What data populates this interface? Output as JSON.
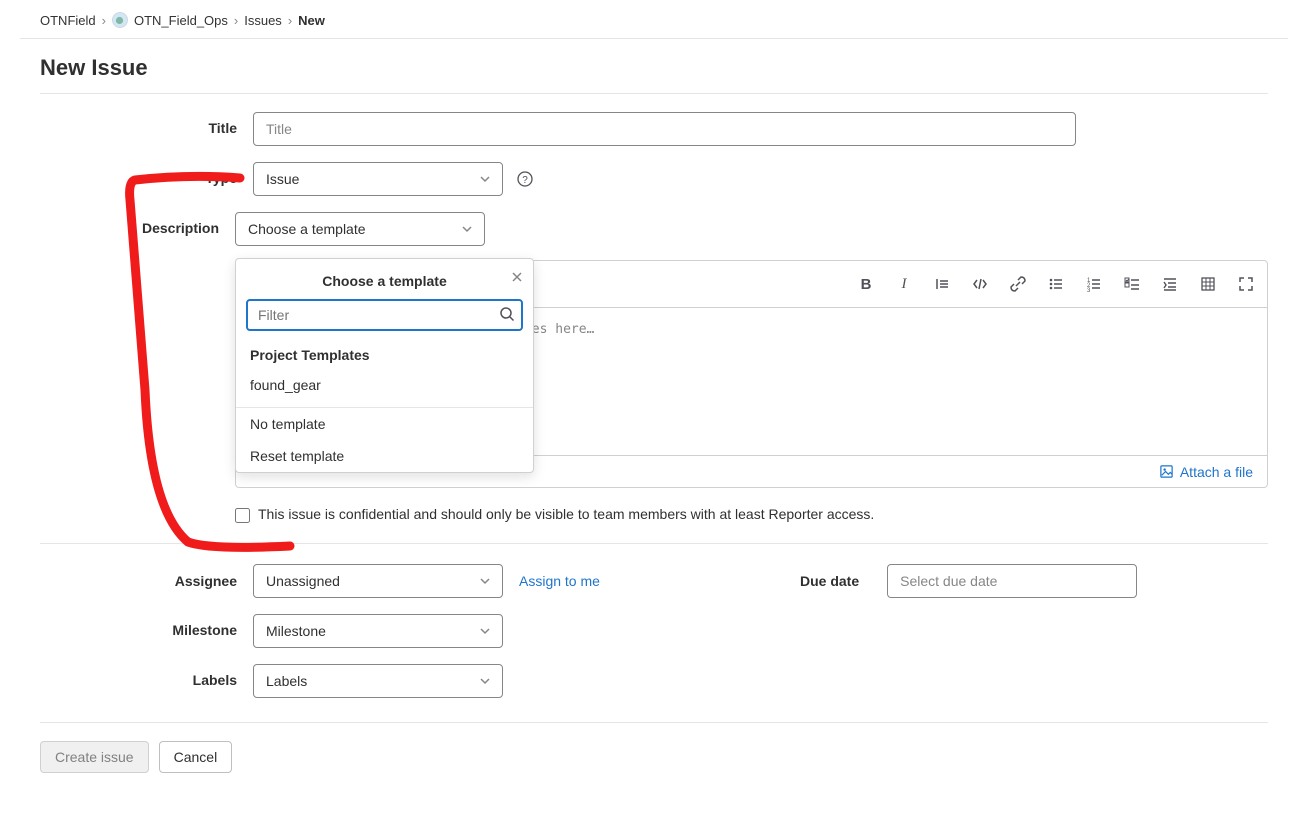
{
  "breadcrumbs": {
    "root": "OTNField",
    "project": "OTN_Field_Ops",
    "section": "Issues",
    "current": "New"
  },
  "page_title": "New Issue",
  "labels": {
    "title": "Title",
    "type": "Type",
    "description": "Description",
    "assignee": "Assignee",
    "due_date": "Due date",
    "milestone": "Milestone",
    "labels_field": "Labels"
  },
  "fields": {
    "title_placeholder": "Title",
    "type_value": "Issue",
    "template_value": "Choose a template",
    "editor_placeholder": "Write a description or drag your files here…",
    "attach_label": "Attach a file",
    "confidential_label": "This issue is confidential and should only be visible to team members with at least Reporter access.",
    "assignee_value": "Unassigned",
    "assign_to_me": "Assign to me",
    "due_date_placeholder": "Select due date",
    "milestone_placeholder": "Milestone",
    "labels_placeholder": "Labels"
  },
  "template_popup": {
    "title": "Choose a template",
    "filter_placeholder": "Filter",
    "section": "Project Templates",
    "items": [
      "found_gear"
    ],
    "no_template": "No template",
    "reset": "Reset template"
  },
  "actions": {
    "create": "Create issue",
    "cancel": "Cancel"
  }
}
